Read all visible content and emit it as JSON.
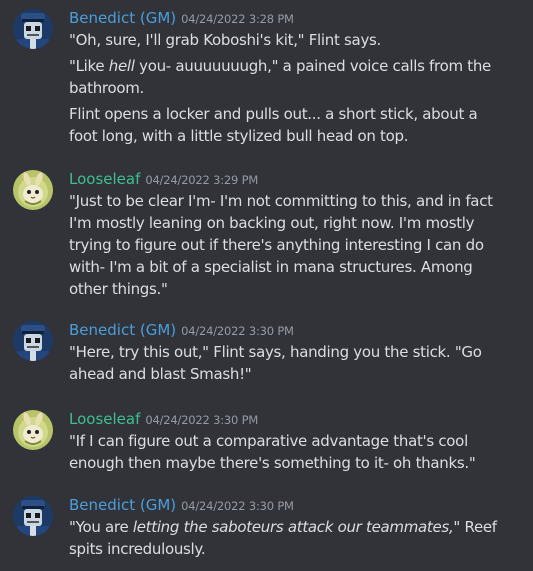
{
  "colors": {
    "background": "#313338",
    "text": "#dbdee1",
    "timestamp": "#949ba4",
    "gm_name": "#4a9edc",
    "looseleaf_name": "#3fbf91"
  },
  "messages": [
    {
      "author": "Benedict (GM)",
      "avatar": "police-robot-avatar",
      "timestamp": "04/24/2022 3:28 PM",
      "lines": [
        "\"Oh, sure, I'll grab Koboshi's kit,\" Flint says."
      ],
      "line2a": "\"Like ",
      "line2_em": "hell",
      "line2b": " you- auuuuuuugh,\" a pained voice calls from the",
      "line3": "bathroom.",
      "line4": "Flint opens a locker and pulls out... a short stick, about a",
      "line5": "foot long, with a little stylized bull head on top."
    },
    {
      "author": "Looseleaf",
      "avatar": "leaf-creature-avatar",
      "timestamp": "04/24/2022 3:29 PM",
      "lines": [
        "\"Just to be clear I'm- I'm not committing to this, and in fact",
        "I'm mostly leaning on backing out, right now. I'm mostly",
        "trying to figure out if there's anything interesting I can do",
        "with- I'm a bit of a specialist in mana structures. Among",
        "other things.\""
      ]
    },
    {
      "author": "Benedict (GM)",
      "avatar": "police-robot-avatar",
      "timestamp": "04/24/2022 3:30 PM",
      "lines": [
        "\"Here, try this out,\" Flint says, handing you the stick. \"Go",
        "ahead and blast Smash!\""
      ]
    },
    {
      "author": "Looseleaf",
      "avatar": "leaf-creature-avatar",
      "timestamp": "04/24/2022 3:30 PM",
      "lines": [
        "\"If I can figure out a comparative advantage that's cool",
        "enough then maybe there's something to it- oh thanks.\""
      ]
    },
    {
      "author": "Benedict (GM)",
      "avatar": "police-robot-avatar",
      "timestamp": "04/24/2022 3:30 PM",
      "line1a": "\"You are ",
      "line1_em": "letting the saboteurs attack our teammates,\"",
      "line1b": " Reef",
      "line2": "spits incredulously."
    }
  ]
}
